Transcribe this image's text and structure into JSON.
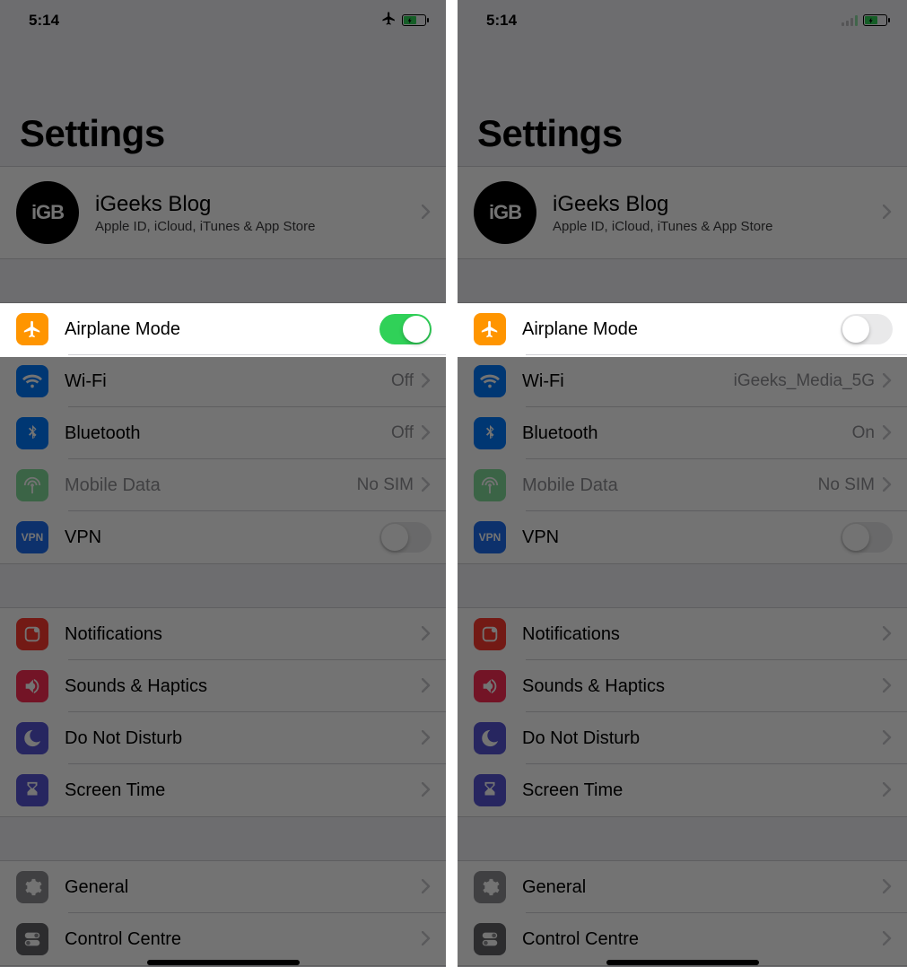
{
  "left": {
    "status": {
      "time": "5:14",
      "airplane_visible": true,
      "signal_visible": false
    },
    "title": "Settings",
    "apple_id": {
      "avatar": "iGB",
      "name": "iGeeks Blog",
      "sub": "Apple ID, iCloud, iTunes & App Store"
    },
    "conn": {
      "airplane": {
        "label": "Airplane Mode",
        "on": true
      },
      "wifi": {
        "label": "Wi-Fi",
        "value": "Off"
      },
      "bluetooth": {
        "label": "Bluetooth",
        "value": "Off"
      },
      "mobile": {
        "label": "Mobile Data",
        "value": "No SIM",
        "disabled": true
      },
      "vpn": {
        "label": "VPN",
        "on": false
      }
    },
    "group2": {
      "notifications": "Notifications",
      "sounds": "Sounds & Haptics",
      "dnd": "Do Not Disturb",
      "screentime": "Screen Time"
    },
    "group3": {
      "general": "General",
      "control_centre": "Control Centre"
    }
  },
  "right": {
    "status": {
      "time": "5:14",
      "airplane_visible": false,
      "signal_visible": true
    },
    "title": "Settings",
    "apple_id": {
      "avatar": "iGB",
      "name": "iGeeks Blog",
      "sub": "Apple ID, iCloud, iTunes & App Store"
    },
    "conn": {
      "airplane": {
        "label": "Airplane Mode",
        "on": false
      },
      "wifi": {
        "label": "Wi-Fi",
        "value": "iGeeks_Media_5G"
      },
      "bluetooth": {
        "label": "Bluetooth",
        "value": "On"
      },
      "mobile": {
        "label": "Mobile Data",
        "value": "No SIM",
        "disabled": true
      },
      "vpn": {
        "label": "VPN",
        "on": false
      }
    },
    "group2": {
      "notifications": "Notifications",
      "sounds": "Sounds & Haptics",
      "dnd": "Do Not Disturb",
      "screentime": "Screen Time"
    },
    "group3": {
      "general": "General",
      "control_centre": "Control Centre"
    }
  },
  "icons": {
    "airplane": "airplane",
    "wifi": "wifi",
    "bluetooth": "bluetooth",
    "mobile": "antenna",
    "vpn": "VPN",
    "notifications": "notify",
    "sounds": "speaker",
    "dnd": "moon",
    "screentime": "hourglass",
    "general": "gear",
    "control_centre": "toggles"
  }
}
